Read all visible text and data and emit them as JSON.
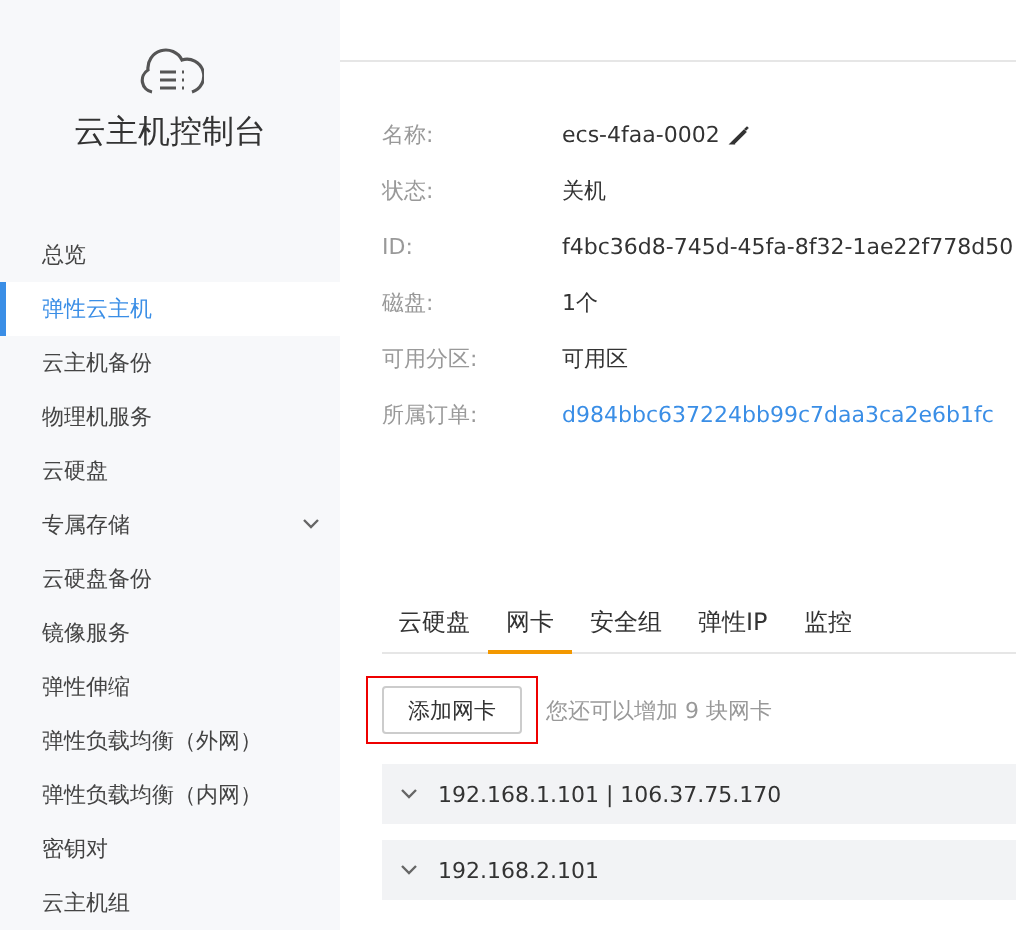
{
  "sidebar": {
    "title": "云主机控制台",
    "items": [
      {
        "label": "总览",
        "selected": false
      },
      {
        "label": "弹性云主机",
        "selected": true
      },
      {
        "label": "云主机备份",
        "selected": false
      },
      {
        "label": "物理机服务",
        "selected": false
      },
      {
        "label": "云硬盘",
        "selected": false
      },
      {
        "label": "专属存储",
        "selected": false,
        "expanded": false
      },
      {
        "label": "云硬盘备份",
        "selected": false
      },
      {
        "label": "镜像服务",
        "selected": false
      },
      {
        "label": "弹性伸缩",
        "selected": false
      },
      {
        "label": "弹性负载均衡（外网）",
        "selected": false
      },
      {
        "label": "弹性负载均衡（内网）",
        "selected": false
      },
      {
        "label": "密钥对",
        "selected": false
      },
      {
        "label": "云主机组",
        "selected": false
      }
    ]
  },
  "details": [
    {
      "label": "名称:",
      "value": "ecs-4faa-0002",
      "kind": "editable"
    },
    {
      "label": "状态:",
      "value": "关机",
      "kind": "text"
    },
    {
      "label": "ID:",
      "value": "f4bc36d8-745d-45fa-8f32-1ae22f778d50",
      "kind": "text"
    },
    {
      "label": "磁盘:",
      "value": "1个",
      "kind": "text"
    },
    {
      "label": "可用分区:",
      "value": "可用区",
      "kind": "text"
    },
    {
      "label": "所属订单:",
      "value": "d984bbc637224bb99c7daa3ca2e6b1fc",
      "kind": "link"
    }
  ],
  "tabs": [
    {
      "label": "云硬盘",
      "selected": false
    },
    {
      "label": "网卡",
      "selected": true
    },
    {
      "label": "安全组",
      "selected": false
    },
    {
      "label": "弹性IP",
      "selected": false
    },
    {
      "label": "监控",
      "selected": false
    }
  ],
  "add_button": {
    "label": "添加网卡",
    "highlighted": true
  },
  "hint": "您还可以增加 9 块网卡",
  "nics": [
    {
      "label": "192.168.1.101 | 106.37.75.170",
      "expanded": false
    },
    {
      "label": "192.168.2.101",
      "expanded": false
    }
  ]
}
